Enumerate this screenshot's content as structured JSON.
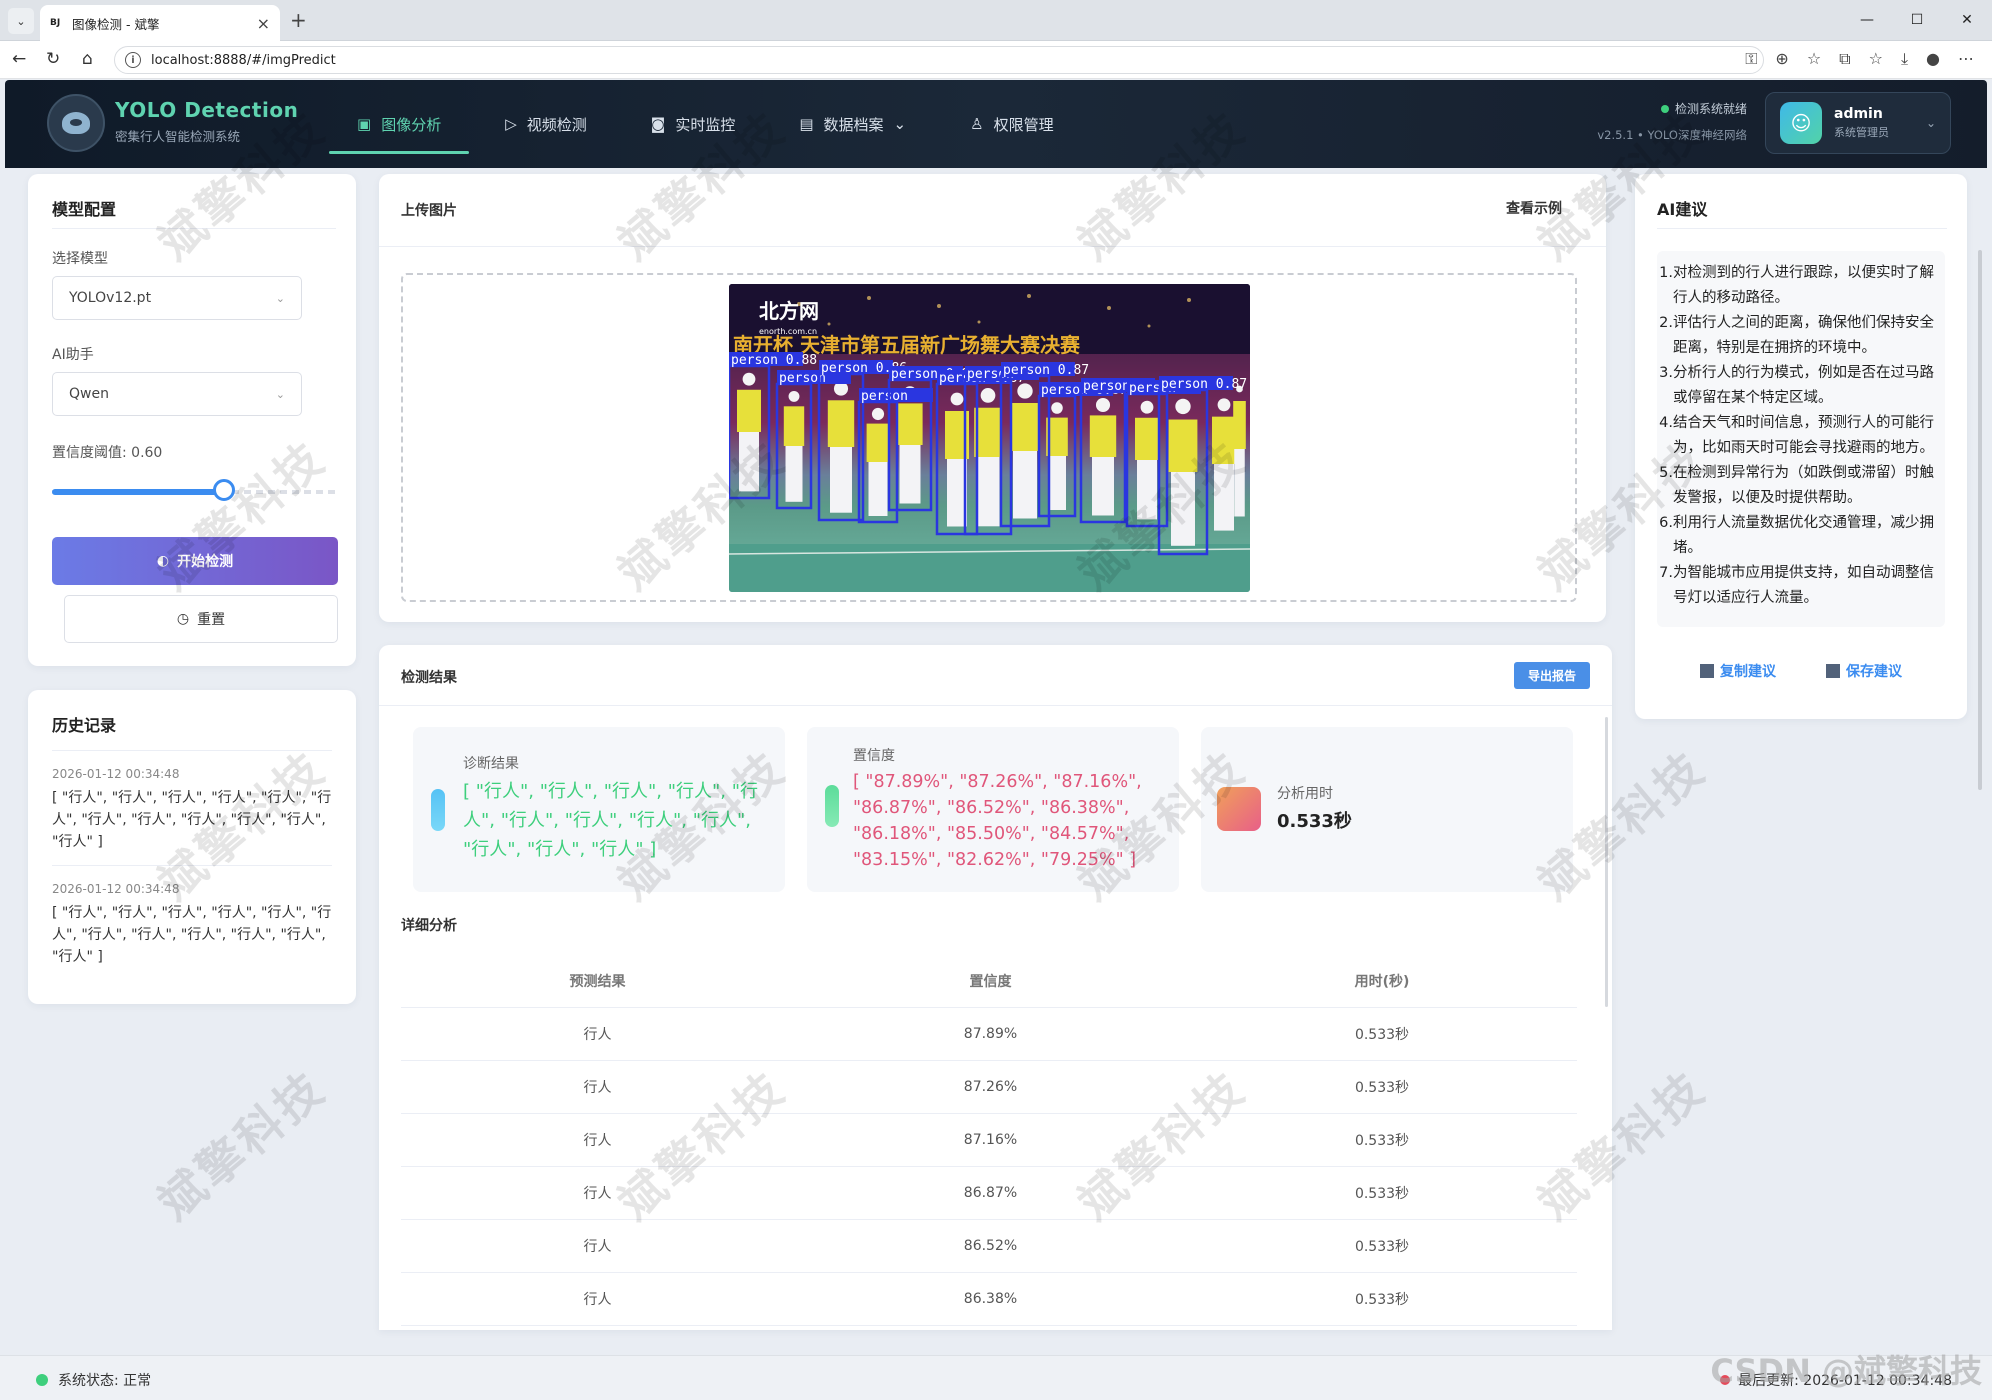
{
  "browser": {
    "tab_favicon": "BJ",
    "tab_title": "图像检测 - 斌擎",
    "url": "localhost:8888/#/imgPredict"
  },
  "header": {
    "brand_title": "YOLO Detection",
    "brand_subtitle": "密集行人智能检测系统",
    "nav": [
      {
        "label": "图像分析",
        "icon": "image-icon"
      },
      {
        "label": "视频检测",
        "icon": "play-icon"
      },
      {
        "label": "实时监控",
        "icon": "camera-icon"
      },
      {
        "label": "数据档案",
        "icon": "document-icon"
      },
      {
        "label": "权限管理",
        "icon": "user-icon"
      }
    ],
    "status_text": "检测系统就绪",
    "version_text": "v2.5.1 • YOLO深度神经网络",
    "user_name": "admin",
    "user_role": "系统管理员"
  },
  "model_config": {
    "title": "模型配置",
    "model_label": "选择模型",
    "model_value": "YOLOv12.pt",
    "assistant_label": "AI助手",
    "assistant_value": "Qwen",
    "confidence_label": "置信度阈值: 0.60",
    "confidence_value": 0.6,
    "start_button": "开始检测",
    "reset_button": "重置"
  },
  "history": {
    "title": "历史记录",
    "items": [
      {
        "time": "2026-01-12 00:34:48",
        "text": "[ \"行人\", \"行人\", \"行人\", \"行人\", \"行人\", \"行人\", \"行人\", \"行人\", \"行人\", \"行人\", \"行人\", \"行人\" ]"
      },
      {
        "time": "2026-01-12 00:34:48",
        "text": "[ \"行人\", \"行人\", \"行人\", \"行人\", \"行人\", \"行人\", \"行人\", \"行人\", \"行人\", \"行人\", \"行人\", \"行人\" ]"
      }
    ]
  },
  "upload": {
    "title": "上传图片",
    "example_link": "查看示例",
    "image_banner_logo": "北方网",
    "image_banner_url": "enorth.com.cn",
    "image_banner_text": "南开杯 天津市第五届新广场舞大赛决赛",
    "detections": [
      "person 0.88",
      "person",
      "person 0.86",
      "person",
      "person 0.83",
      "person 0.87",
      "person",
      "person 0.87",
      "person 0.87",
      "person 0.85",
      "person",
      "person 0.87"
    ]
  },
  "results": {
    "title": "检测结果",
    "export_button": "导出报告",
    "diagnosis_label": "诊断结果",
    "diagnosis_value": "[ \"行人\", \"行人\", \"行人\", \"行人\", \"行人\", \"行人\", \"行人\", \"行人\", \"行人\", \"行人\", \"行人\", \"行人\" ]",
    "confidence_label": "置信度",
    "confidence_value": "[ \"87.89%\", \"87.26%\", \"87.16%\", \"86.87%\", \"86.52%\", \"86.38%\", \"86.18%\", \"85.50%\", \"84.57%\", \"83.15%\", \"82.62%\", \"79.25%\" ]",
    "time_label": "分析用时",
    "time_value": "0.533秒",
    "detail_title": "详细分析",
    "columns": [
      "预测结果",
      "置信度",
      "用时(秒)"
    ],
    "rows": [
      [
        "行人",
        "87.89%",
        "0.533秒"
      ],
      [
        "行人",
        "87.26%",
        "0.533秒"
      ],
      [
        "行人",
        "87.16%",
        "0.533秒"
      ],
      [
        "行人",
        "86.87%",
        "0.533秒"
      ],
      [
        "行人",
        "86.52%",
        "0.533秒"
      ],
      [
        "行人",
        "86.38%",
        "0.533秒"
      ]
    ]
  },
  "advice": {
    "title": "AI建议",
    "items": [
      {
        "num": "1.",
        "text": "对检测到的行人进行跟踪，以便实时了解行人的移动路径。"
      },
      {
        "num": "2.",
        "text": "评估行人之间的距离，确保他们保持安全距离，特别是在拥挤的环境中。"
      },
      {
        "num": "3.",
        "text": "分析行人的行为模式，例如是否在过马路或停留在某个特定区域。"
      },
      {
        "num": "4.",
        "text": "结合天气和时间信息，预测行人的可能行为，比如雨天时可能会寻找避雨的地方。"
      },
      {
        "num": "5.",
        "text": "在检测到异常行为（如跌倒或滞留）时触发警报，以便及时提供帮助。"
      },
      {
        "num": "6.",
        "text": "利用行人流量数据优化交通管理，减少拥堵。"
      },
      {
        "num": "7.",
        "text": "为智能城市应用提供支持，如自动调整信号灯以适应行人流量。"
      }
    ],
    "copy_button": "复制建议",
    "save_button": "保存建议"
  },
  "footer": {
    "status": "系统状态: 正常",
    "last_update": "最后更新: 2026-01-12 00:34:48"
  },
  "watermark": "斌擎科技",
  "csdn_mark": "CSDN @斌擎科技",
  "colors": {
    "accent": "#5fd3b0",
    "primary": "#3b8cf0",
    "diagnosis": "#3ecf7d",
    "confidence": "#e0567a"
  }
}
